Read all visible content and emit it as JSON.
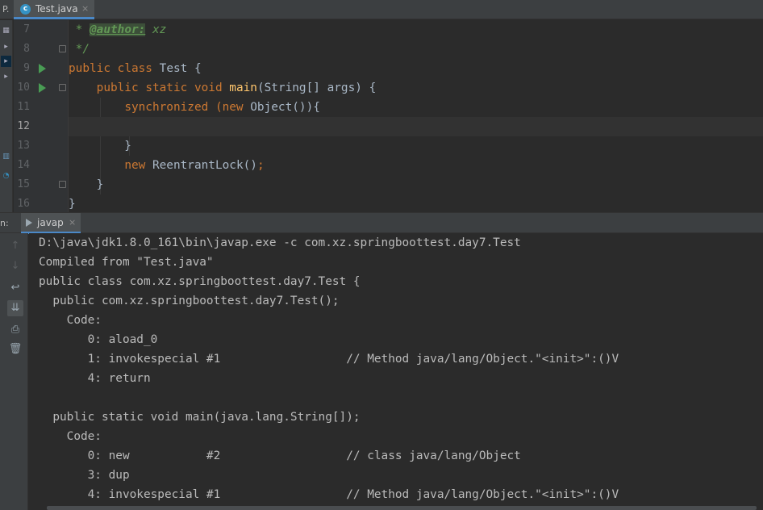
{
  "window": {
    "project_tab_label": "P.",
    "file_tab": {
      "label": "Test.java",
      "icon": "class-c-icon",
      "close": "×"
    }
  },
  "editor": {
    "lines": [
      {
        "number": "7"
      },
      {
        "number": "8"
      },
      {
        "number": "9"
      },
      {
        "number": "10"
      },
      {
        "number": "11"
      },
      {
        "number": "12"
      },
      {
        "number": "13"
      },
      {
        "number": "14"
      },
      {
        "number": "15"
      },
      {
        "number": "16"
      }
    ],
    "code": {
      "l7_star": " * ",
      "l7_tag": "@author:",
      "l7_name": " xz",
      "l8": " */",
      "l9_kw1": "public",
      "l9_kw2": "class",
      "l9_name": "Test {",
      "l10_indent": "    ",
      "l10_kw1": "public",
      "l10_kw2": "static",
      "l10_kw3": "void",
      "l10_fn": "main",
      "l10_rest": "(String[] args) {",
      "l11_indent": "        ",
      "l11_kw1": "synchronized",
      "l11_paren": " (",
      "l11_kw2": "new",
      "l11_rest": " Object()){",
      "l13": "        }",
      "l14_indent": "        ",
      "l14_kw": "new",
      "l14_rest": " ReentrantLock()",
      "l14_semi": ";",
      "l15": "    }",
      "l16": "}"
    },
    "current_line": "12"
  },
  "run_panel": {
    "label": "n:",
    "tab": {
      "label": "javap",
      "close": "×"
    },
    "toolbar": [
      "up-arrow-icon",
      "down-arrow-icon",
      "soft-wrap-icon",
      "scroll-to-end-icon",
      "print-icon",
      "trash-icon"
    ],
    "console_lines": [
      "D:\\java\\jdk1.8.0_161\\bin\\javap.exe -c com.xz.springboottest.day7.Test",
      "Compiled from \"Test.java\"",
      "public class com.xz.springboottest.day7.Test {",
      "  public com.xz.springboottest.day7.Test();",
      "    Code:",
      "       0: aload_0",
      "       1: invokespecial #1                  // Method java/lang/Object.\"<init>\":()V",
      "       4: return",
      "",
      "  public static void main(java.lang.String[]);",
      "    Code:",
      "       0: new           #2                  // class java/lang/Object",
      "       3: dup",
      "       4: invokespecial #1                  // Method java/lang/Object.\"<init>\":()V"
    ]
  },
  "colors": {
    "keyword": "#cc7832",
    "function": "#ffc66d",
    "comment": "#629755",
    "run_gutter": "#499c54",
    "accent": "#4a88c7"
  }
}
